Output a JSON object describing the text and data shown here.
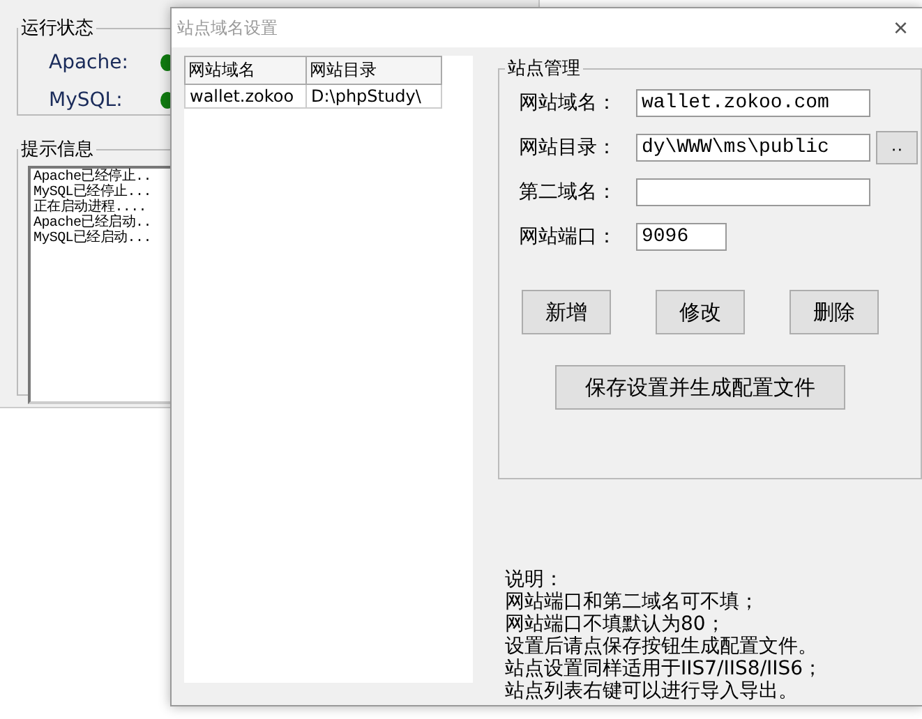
{
  "main": {
    "status_group": {
      "title": "运行状态",
      "services": [
        {
          "name": "Apache:",
          "running": true
        },
        {
          "name": "MySQL:",
          "running": true
        }
      ]
    },
    "log_group": {
      "title": "提示信息",
      "lines": [
        "Apache已经停止..",
        "MySQL已经停止...",
        "正在启动进程....",
        "Apache已经启动..",
        "MySQL已经启动..."
      ]
    }
  },
  "dialog": {
    "title": "站点域名设置",
    "close": "×",
    "table": {
      "columns": [
        "网站域名",
        "网站目录"
      ],
      "rows": [
        [
          "wallet.zokoo",
          "D:\\phpStudy\\"
        ]
      ]
    },
    "group_title": "站点管理",
    "fields": [
      {
        "kind": "text",
        "label": "网站域名：",
        "value": "wallet.zokoo.com"
      },
      {
        "kind": "text",
        "label": "网站目录：",
        "value": "dy\\WWW\\ms\\public",
        "browse": "··"
      },
      {
        "kind": "text",
        "label": "第二域名："
      },
      {
        "kind": "port",
        "label": "网站端口：",
        "value": "9096"
      }
    ],
    "buttons": [
      "新增",
      "修改",
      "删除"
    ],
    "save_button": "保存设置并生成配置文件",
    "notes": [
      "说明：",
      "网站端口和第二域名可不填；",
      "网站端口不填默认为80；",
      "设置后请点保存按钮生成配置文件。",
      "站点设置同样适用于IIS7/IIS8/IIS6；",
      "站点列表右键可以进行导入导出。"
    ]
  }
}
